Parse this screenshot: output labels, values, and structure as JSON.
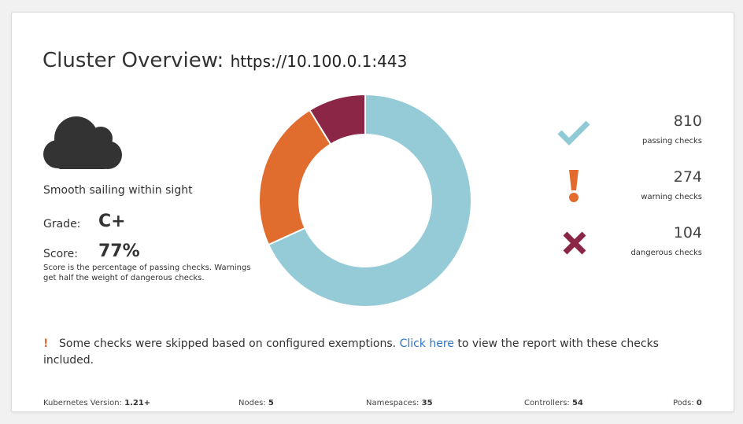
{
  "title": {
    "label": "Cluster Overview:",
    "url": "https://10.100.0.1:443"
  },
  "summary": {
    "weather_icon": "cloud-icon",
    "weather_text": "Smooth sailing within sight",
    "grade_label": "Grade:",
    "grade_value": "C+",
    "score_label": "Score:",
    "score_value": "77%",
    "score_description": "Score is the percentage of passing checks. Warnings get half the weight of dangerous checks."
  },
  "stats": [
    {
      "icon": "checkmark-icon",
      "count": "810",
      "label": "passing checks",
      "color": "#8fcad6"
    },
    {
      "icon": "exclamation-icon",
      "count": "274",
      "label": "warning checks",
      "color": "#e26b2d"
    },
    {
      "icon": "x-mark-icon",
      "count": "104",
      "label": "dangerous checks",
      "color": "#8b2646"
    }
  ],
  "chart_data": {
    "type": "pie",
    "donut": true,
    "categories": [
      "passing checks",
      "warning checks",
      "dangerous checks"
    ],
    "values": [
      810,
      274,
      104
    ],
    "colors": [
      "#95cbd6",
      "#e06c2e",
      "#8b2646"
    ]
  },
  "skip_note": {
    "icon": "exclamation-icon",
    "text_before": "Some checks were skipped based on configured exemptions. ",
    "link_text": "Click here",
    "text_after": " to view the report with these checks included."
  },
  "footer": {
    "kubernetes_label": "Kubernetes Version: ",
    "kubernetes_value": "1.21+",
    "nodes_label": "Nodes: ",
    "nodes_value": "5",
    "namespaces_label": "Namespaces: ",
    "namespaces_value": "35",
    "controllers_label": "Controllers: ",
    "controllers_value": "54",
    "pods_label": "Pods: ",
    "pods_value": "0"
  }
}
